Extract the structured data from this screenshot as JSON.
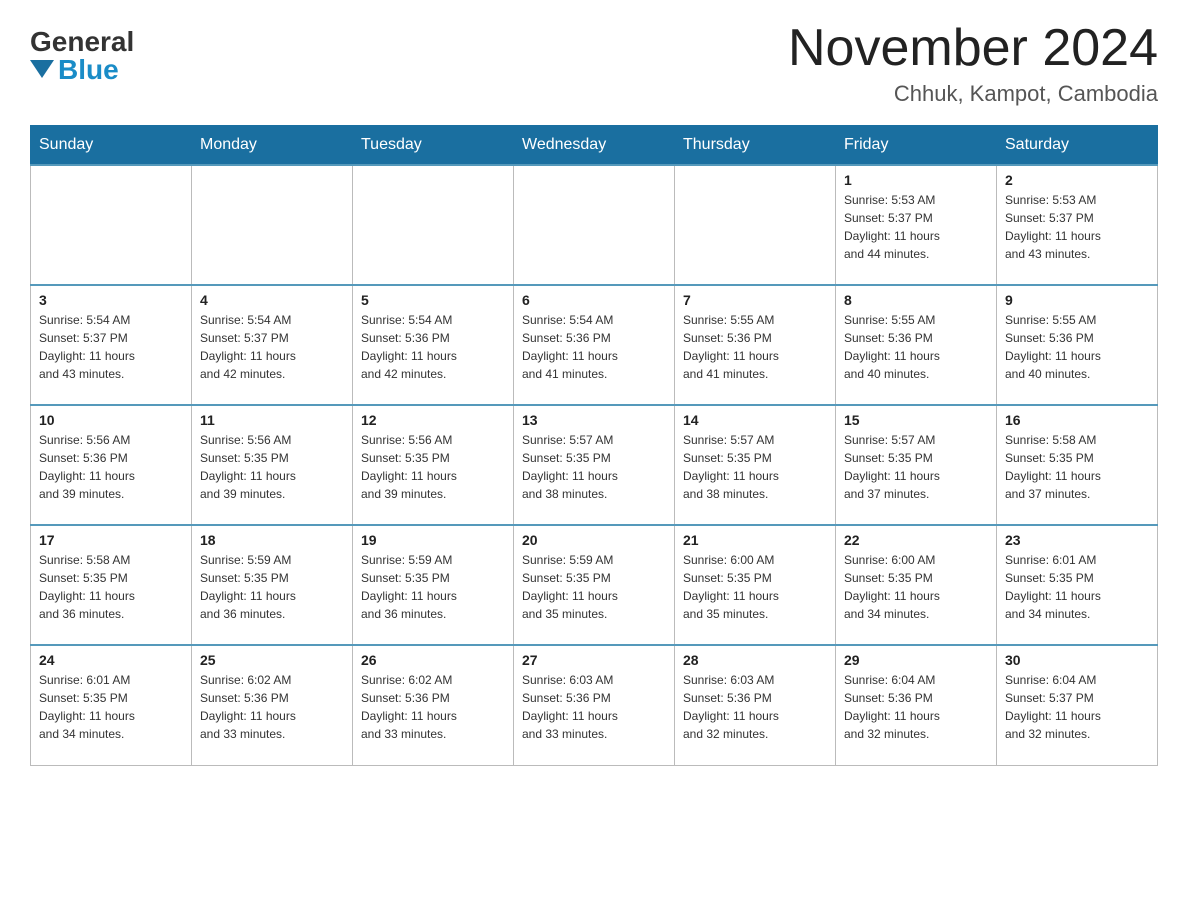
{
  "logo": {
    "general": "General",
    "blue": "Blue"
  },
  "title": "November 2024",
  "subtitle": "Chhuk, Kampot, Cambodia",
  "days": [
    "Sunday",
    "Monday",
    "Tuesday",
    "Wednesday",
    "Thursday",
    "Friday",
    "Saturday"
  ],
  "weeks": [
    [
      {
        "num": "",
        "info": ""
      },
      {
        "num": "",
        "info": ""
      },
      {
        "num": "",
        "info": ""
      },
      {
        "num": "",
        "info": ""
      },
      {
        "num": "",
        "info": ""
      },
      {
        "num": "1",
        "info": "Sunrise: 5:53 AM\nSunset: 5:37 PM\nDaylight: 11 hours\nand 44 minutes."
      },
      {
        "num": "2",
        "info": "Sunrise: 5:53 AM\nSunset: 5:37 PM\nDaylight: 11 hours\nand 43 minutes."
      }
    ],
    [
      {
        "num": "3",
        "info": "Sunrise: 5:54 AM\nSunset: 5:37 PM\nDaylight: 11 hours\nand 43 minutes."
      },
      {
        "num": "4",
        "info": "Sunrise: 5:54 AM\nSunset: 5:37 PM\nDaylight: 11 hours\nand 42 minutes."
      },
      {
        "num": "5",
        "info": "Sunrise: 5:54 AM\nSunset: 5:36 PM\nDaylight: 11 hours\nand 42 minutes."
      },
      {
        "num": "6",
        "info": "Sunrise: 5:54 AM\nSunset: 5:36 PM\nDaylight: 11 hours\nand 41 minutes."
      },
      {
        "num": "7",
        "info": "Sunrise: 5:55 AM\nSunset: 5:36 PM\nDaylight: 11 hours\nand 41 minutes."
      },
      {
        "num": "8",
        "info": "Sunrise: 5:55 AM\nSunset: 5:36 PM\nDaylight: 11 hours\nand 40 minutes."
      },
      {
        "num": "9",
        "info": "Sunrise: 5:55 AM\nSunset: 5:36 PM\nDaylight: 11 hours\nand 40 minutes."
      }
    ],
    [
      {
        "num": "10",
        "info": "Sunrise: 5:56 AM\nSunset: 5:36 PM\nDaylight: 11 hours\nand 39 minutes."
      },
      {
        "num": "11",
        "info": "Sunrise: 5:56 AM\nSunset: 5:35 PM\nDaylight: 11 hours\nand 39 minutes."
      },
      {
        "num": "12",
        "info": "Sunrise: 5:56 AM\nSunset: 5:35 PM\nDaylight: 11 hours\nand 39 minutes."
      },
      {
        "num": "13",
        "info": "Sunrise: 5:57 AM\nSunset: 5:35 PM\nDaylight: 11 hours\nand 38 minutes."
      },
      {
        "num": "14",
        "info": "Sunrise: 5:57 AM\nSunset: 5:35 PM\nDaylight: 11 hours\nand 38 minutes."
      },
      {
        "num": "15",
        "info": "Sunrise: 5:57 AM\nSunset: 5:35 PM\nDaylight: 11 hours\nand 37 minutes."
      },
      {
        "num": "16",
        "info": "Sunrise: 5:58 AM\nSunset: 5:35 PM\nDaylight: 11 hours\nand 37 minutes."
      }
    ],
    [
      {
        "num": "17",
        "info": "Sunrise: 5:58 AM\nSunset: 5:35 PM\nDaylight: 11 hours\nand 36 minutes."
      },
      {
        "num": "18",
        "info": "Sunrise: 5:59 AM\nSunset: 5:35 PM\nDaylight: 11 hours\nand 36 minutes."
      },
      {
        "num": "19",
        "info": "Sunrise: 5:59 AM\nSunset: 5:35 PM\nDaylight: 11 hours\nand 36 minutes."
      },
      {
        "num": "20",
        "info": "Sunrise: 5:59 AM\nSunset: 5:35 PM\nDaylight: 11 hours\nand 35 minutes."
      },
      {
        "num": "21",
        "info": "Sunrise: 6:00 AM\nSunset: 5:35 PM\nDaylight: 11 hours\nand 35 minutes."
      },
      {
        "num": "22",
        "info": "Sunrise: 6:00 AM\nSunset: 5:35 PM\nDaylight: 11 hours\nand 34 minutes."
      },
      {
        "num": "23",
        "info": "Sunrise: 6:01 AM\nSunset: 5:35 PM\nDaylight: 11 hours\nand 34 minutes."
      }
    ],
    [
      {
        "num": "24",
        "info": "Sunrise: 6:01 AM\nSunset: 5:35 PM\nDaylight: 11 hours\nand 34 minutes."
      },
      {
        "num": "25",
        "info": "Sunrise: 6:02 AM\nSunset: 5:36 PM\nDaylight: 11 hours\nand 33 minutes."
      },
      {
        "num": "26",
        "info": "Sunrise: 6:02 AM\nSunset: 5:36 PM\nDaylight: 11 hours\nand 33 minutes."
      },
      {
        "num": "27",
        "info": "Sunrise: 6:03 AM\nSunset: 5:36 PM\nDaylight: 11 hours\nand 33 minutes."
      },
      {
        "num": "28",
        "info": "Sunrise: 6:03 AM\nSunset: 5:36 PM\nDaylight: 11 hours\nand 32 minutes."
      },
      {
        "num": "29",
        "info": "Sunrise: 6:04 AM\nSunset: 5:36 PM\nDaylight: 11 hours\nand 32 minutes."
      },
      {
        "num": "30",
        "info": "Sunrise: 6:04 AM\nSunset: 5:37 PM\nDaylight: 11 hours\nand 32 minutes."
      }
    ]
  ]
}
